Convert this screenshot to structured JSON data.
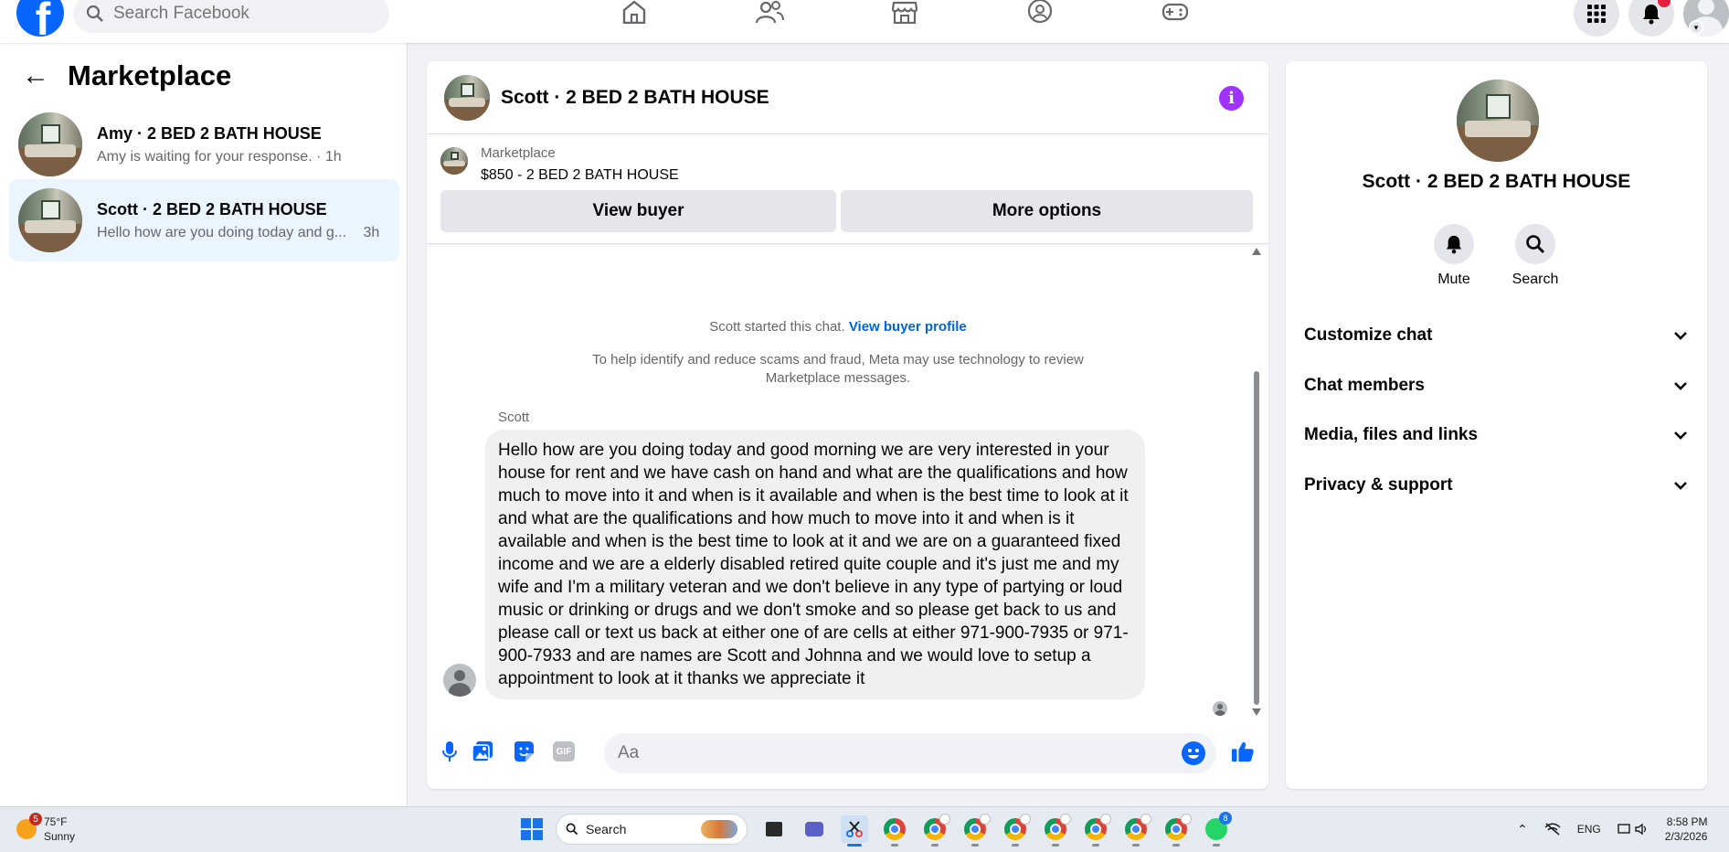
{
  "topbar": {
    "logo_letter": "f",
    "search_placeholder": "Search Facebook",
    "nav": [
      "home-icon",
      "friends-icon",
      "marketplace-icon",
      "groups-icon",
      "gaming-icon"
    ],
    "right": [
      "menu-grid-icon",
      "notifications-bell-icon",
      "profile-avatar"
    ]
  },
  "sidebar": {
    "title": "Marketplace",
    "back_icon": "←",
    "conversations": [
      {
        "title": "Amy · 2 BED 2 BATH HOUSE",
        "preview": "Amy is waiting for your response. · 1h",
        "active": false
      },
      {
        "title": "Scott · 2 BED 2 BATH HOUSE",
        "preview": "Hello how are you doing today and g...",
        "time": "3h",
        "active": true
      }
    ]
  },
  "chat": {
    "title": "Scott · 2 BED 2 BATH HOUSE",
    "info_glyph": "i",
    "listing_source": "Marketplace",
    "listing_title": "$850 - 2 BED 2 BATH HOUSE",
    "view_buyer_label": "View buyer",
    "more_options_label": "More options",
    "started_text": "Scott started this chat.",
    "view_profile_link": "View buyer profile",
    "scam_notice": "To help identify and reduce scams and fraud, Meta may use technology to review Marketplace messages.",
    "sender": "Scott",
    "message": "Hello how are you doing today and good morning we are very interested in your house for rent and we have cash on hand and what are the qualifications and how much to move into it and when is it available and when is the best time to look at it and what are the qualifications and how much to move into it and when is it available and when is the best time to look at it and we are on a guaranteed fixed income and we are a elderly disabled retired quite couple and it's just me and my wife and I'm a military veteran and we don't believe in any type of partying or loud music or drinking or drugs and we don't smoke and so please get back to us and please call or text us back at either one of are cells at either 971-900-7935 or 971-900-7933 and are names are Scott and Johnna and we would love to setup a appointment to look at it thanks we appreciate it",
    "composer_placeholder": "Aa",
    "composer_icons": [
      "microphone-icon",
      "photo-icon",
      "sticker-icon",
      "gif-icon",
      "emoji-icon",
      "thumbs-up-icon"
    ],
    "gif_label": "GIF"
  },
  "details": {
    "name": "Scott · 2 BED 2 BATH HOUSE",
    "mute_label": "Mute",
    "search_label": "Search",
    "sections": [
      "Customize chat",
      "Chat members",
      "Media, files and links",
      "Privacy & support"
    ]
  },
  "taskbar": {
    "weather_badge": "5",
    "temperature": "75°F",
    "condition": "Sunny",
    "search_placeholder": "Search",
    "whatsapp_badge": "8",
    "language": "ENG",
    "time": "8:58 PM",
    "date": "2/3/2026"
  },
  "colors": {
    "brand": "#0866ff",
    "active_conversation": "#ebf5ff",
    "link": "#0064d1",
    "info_icon": "#a033ff"
  }
}
